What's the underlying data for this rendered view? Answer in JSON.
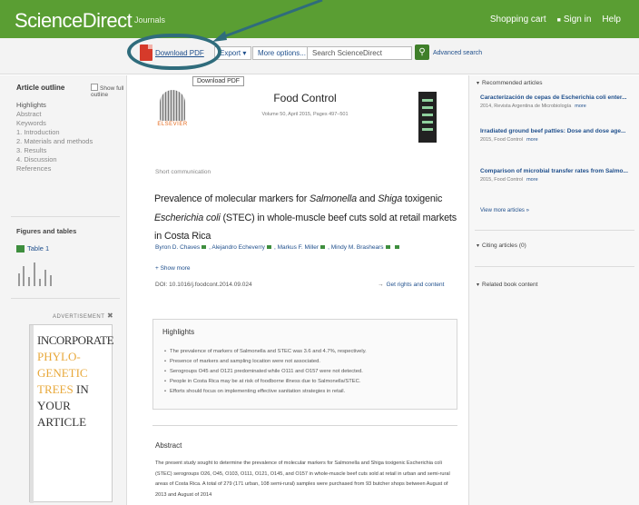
{
  "header": {
    "brand": "ScienceDirect",
    "journals_link": "Journals",
    "nav": [
      "Shopping cart",
      "Sign in",
      "Help"
    ]
  },
  "toolbar": {
    "download_label": "Download PDF",
    "export_label": "Export ▾",
    "more_options_label": "More options... ▾",
    "search_placeholder": "Search ScienceDirect",
    "search_icon": "search-icon",
    "advanced_search": "Advanced search",
    "tooltip": "Download PDF"
  },
  "outline": {
    "title": "Article outline",
    "show_full": "Show full outline",
    "items": [
      "Highlights",
      "Abstract",
      "Keywords",
      "1. Introduction",
      "2. Materials and methods",
      "3. Results",
      "4. Discussion",
      "References"
    ]
  },
  "figures": {
    "title": "Figures and tables",
    "table_label": "Table 1"
  },
  "ad": {
    "label": "ADVERTISEMENT",
    "close": "✖",
    "words": [
      "INCORPORATE",
      "PHYLO-",
      "GENETIC",
      "TREES",
      "IN",
      "YOUR",
      "ARTICLE"
    ]
  },
  "article": {
    "publisher": "ELSEVIER",
    "journal": "Food Control",
    "volume": "Volume 50, April 2015, Pages 497–501",
    "type": "Short communication",
    "title_parts": {
      "a": "Prevalence of molecular markers for ",
      "b": "Salmonella",
      "c": " and ",
      "d": "Shiga",
      "e": " toxigenic ",
      "f": "Escherichia coli",
      "g": " (STEC) in whole-muscle beef cuts sold at retail markets in Costa Rica"
    },
    "authors": [
      "Byron D. Chaves",
      "Alejandro Echeverry",
      "Markus F. Miller",
      "Mindy M. Brashears"
    ],
    "show_more": "+ Show more",
    "doi": "DOI: 10.1016/j.foodcont.2014.09.024",
    "rights": "Get rights and content"
  },
  "highlights": {
    "title": "Highlights",
    "items": [
      "The prevalence of markers of Salmonella and STEC was 3.6 and 4.7%, respectively.",
      "Presence of markers and sampling location were not associated.",
      "Serogroups O45 and O121 predominated while O111 and O157 were not detected.",
      "People in Costa Rica may be at risk of foodborne illness due to Salmonella/STEC.",
      "Efforts should focus on implementing effective sanitation strategies in retail."
    ]
  },
  "abstract": {
    "title": "Abstract",
    "text": "The present study sought to determine the prevalence of molecular markers for Salmonella and Shiga toxigenic Escherichia coli (STEC) serogroups O26, O45, O103, O111, O121, O145, and O157 in whole-muscle beef cuts sold at retail in urban and semi-rural areas of Costa Rica. A total of 279 (171 urban, 108 semi-rural) samples were purchased from 93 butcher shops between August of 2013 and August of 2014"
  },
  "recommended": {
    "title": "Recommended articles",
    "items": [
      {
        "title": "Caracterización de cepas de Escherichia coli enter...",
        "meta": "2014, Revista Argentina de Microbiología",
        "pdf": "more"
      },
      {
        "title": "Irradiated ground beef patties: Dose and dose age...",
        "meta": "2015, Food Control",
        "pdf": "more"
      },
      {
        "title": "Comparison of microbial transfer rates from Salmo...",
        "meta": "2015, Food Control",
        "pdf": "more"
      }
    ],
    "view_more": "View more articles »",
    "citing": "Citing articles (0)",
    "related": "Related book content"
  }
}
